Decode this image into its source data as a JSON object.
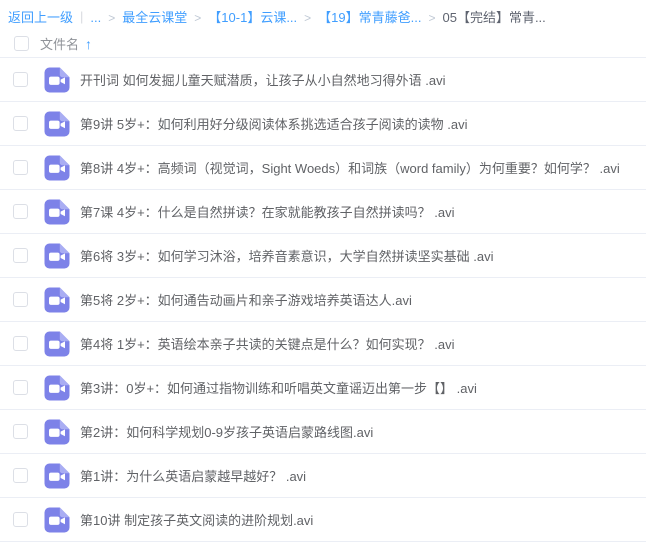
{
  "breadcrumb": {
    "back_label": "返回上一级",
    "pipe_separator": "|",
    "separator": ">",
    "items": [
      {
        "label": "...",
        "link": true
      },
      {
        "label": "最全云课堂",
        "link": true
      },
      {
        "label": "【10-1】云课...",
        "link": true
      },
      {
        "label": "【19】常青藤爸...",
        "link": true
      },
      {
        "label": "05【完结】常青...",
        "link": false
      }
    ]
  },
  "header": {
    "column_label": "文件名",
    "sort_arrow": "↑"
  },
  "files": [
    {
      "name": "开刊词 如何发掘儿童天赋潜质，让孩子从小自然地习得外语 .avi",
      "icon": "video-file-icon"
    },
    {
      "name": "第9讲 5岁+：如何利用好分级阅读体系挑选适合孩子阅读的读物 .avi",
      "icon": "video-file-icon"
    },
    {
      "name": "第8讲 4岁+：高频词（视觉词，Sight Woeds）和词族（word family）为何重要？如何学？ .avi",
      "icon": "video-file-icon"
    },
    {
      "name": "第7课 4岁+：什么是自然拼读？在家就能教孩子自然拼读吗？ .avi",
      "icon": "video-file-icon"
    },
    {
      "name": "第6将 3岁+：如何学习沐浴，培养音素意识，大学自然拼读坚实基础 .avi",
      "icon": "video-file-icon"
    },
    {
      "name": "第5将 2岁+：如何通告动画片和亲子游戏培养英语达人.avi",
      "icon": "video-file-icon"
    },
    {
      "name": "第4将 1岁+：英语绘本亲子共读的关键点是什么？如何实现？ .avi",
      "icon": "video-file-icon"
    },
    {
      "name": "第3讲：0岁+：如何通过指物训练和听唱英文童谣迈出第一步【】 .avi",
      "icon": "video-file-icon"
    },
    {
      "name": "第2讲：如何科学规划0-9岁孩子英语启蒙路线图.avi",
      "icon": "video-file-icon"
    },
    {
      "name": "第1讲：为什么英语启蒙越早越好？ .avi",
      "icon": "video-file-icon"
    },
    {
      "name": "第10讲 制定孩子英文阅读的进阶规划.avi",
      "icon": "video-file-icon"
    }
  ],
  "colors": {
    "link_blue": "#409eff",
    "file_icon_purple": "#7d82e8",
    "file_icon_fold": "#a9adf3",
    "row_border": "#ebeef5",
    "text_primary": "#606266",
    "text_secondary": "#909399"
  }
}
